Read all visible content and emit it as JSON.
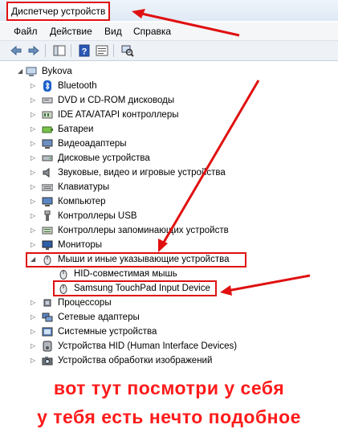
{
  "window": {
    "title": "Диспетчер устройств"
  },
  "menu": [
    "Файл",
    "Действие",
    "Вид",
    "Справка"
  ],
  "toolbar_icons": [
    "back-arrow-icon",
    "forward-arrow-icon",
    "show-hide-console-tree-icon",
    "help-icon",
    "properties-icon",
    "scan-hardware-icon"
  ],
  "tree": {
    "root": "Bykova",
    "categories": [
      "Bluetooth",
      "DVD и CD-ROM дисководы",
      "IDE ATA/ATAPI контроллеры",
      "Батареи",
      "Видеоадаптеры",
      "Дисковые устройства",
      "Звуковые, видео и игровые устройства",
      "Клавиатуры",
      "Компьютер",
      "Контроллеры USB",
      "Контроллеры запоминающих устройств",
      "Мониторы",
      "Мыши и иные указывающие устройства",
      "HID-совместимая мышь",
      "Samsung TouchPad Input Device",
      "Процессоры",
      "Сетевые адаптеры",
      "Системные устройства",
      "Устройства HID (Human Interface Devices)",
      "Устройства обработки изображений"
    ]
  },
  "caption": {
    "line1": "вот тут посмотри у себя",
    "line2": "у тебя есть нечто подобное"
  },
  "colors": {
    "annotation": "#e01010",
    "caption": "#ff1a1a"
  }
}
